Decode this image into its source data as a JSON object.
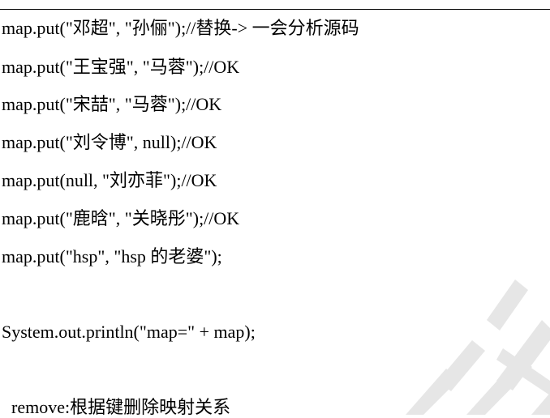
{
  "code": {
    "lines": [
      "map.put(\"邓超\", \"孙俪\");//替换-> 一会分析源码",
      "map.put(\"王宝强\", \"马蓉\");//OK",
      "map.put(\"宋喆\", \"马蓉\");//OK",
      "map.put(\"刘令博\", null);//OK",
      "map.put(null, \"刘亦菲\");//OK",
      "map.put(\"鹿晗\", \"关晓彤\");//OK",
      "map.put(\"hsp\", \"hsp 的老婆\");",
      "System.out.println(\"map=\" + map);"
    ]
  },
  "remove_line": "remove:根据键删除映射关系",
  "colors": {
    "text": "#000000",
    "watermark": "#e6e6e6",
    "rule": "#000000"
  }
}
